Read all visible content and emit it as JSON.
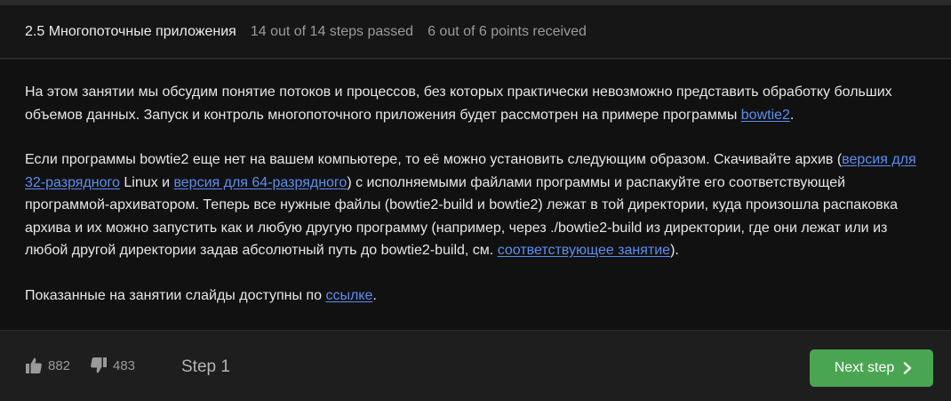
{
  "header": {
    "title": "2.5 Многопоточные приложения",
    "steps_passed": "14 out of 14 steps passed",
    "points": "6 out of 6 points  received"
  },
  "content": {
    "p1_text": "На этом занятии мы обсудим понятие потоков и процессов, без которых практически невозможно представить обработку больших объемов данных. Запуск и контроль многопоточного приложения будет рассмотрен на примере программы ",
    "p1_link": "bowtie2",
    "p1_end": ".",
    "p2_text1": "Если программы bowtie2 еще нет на вашем компьютере, то её можно установить следующим образом. Скачивайте архив (",
    "p2_link1": "версия для 32-разрядного",
    "p2_text2": " Linux и ",
    "p2_link2": "версия для 64-разрядного",
    "p2_text3": ") с исполняемыми файлами программы и распакуйте его соответствующей программой-архиватором. Теперь все нужные файлы (bowtie2-build и bowtie2) лежат в той директории, куда произошла распаковка архива и их можно запустить как и любую другую программу (например, через ./bowtie2-build из директории, где они лежат или из любой другой директории задав абсолютный путь до bowtie2-build, см. ",
    "p2_link3": "соответствующее занятие",
    "p2_end": ").",
    "p3_text": "Показанные на занятии слайды доступны по ",
    "p3_link": "ссылке",
    "p3_end": "."
  },
  "footer": {
    "likes": "882",
    "dislikes": "483",
    "step_label": "Step 1",
    "next_label": "Next step"
  },
  "icons": {
    "like": "thumbs-up-icon",
    "dislike": "thumbs-down-icon",
    "next": "chevron-right-icon"
  },
  "colors": {
    "link": "#5b8ff0",
    "next_button": "#4aa552",
    "content_bg": "#111111",
    "header_bg": "#161616"
  }
}
